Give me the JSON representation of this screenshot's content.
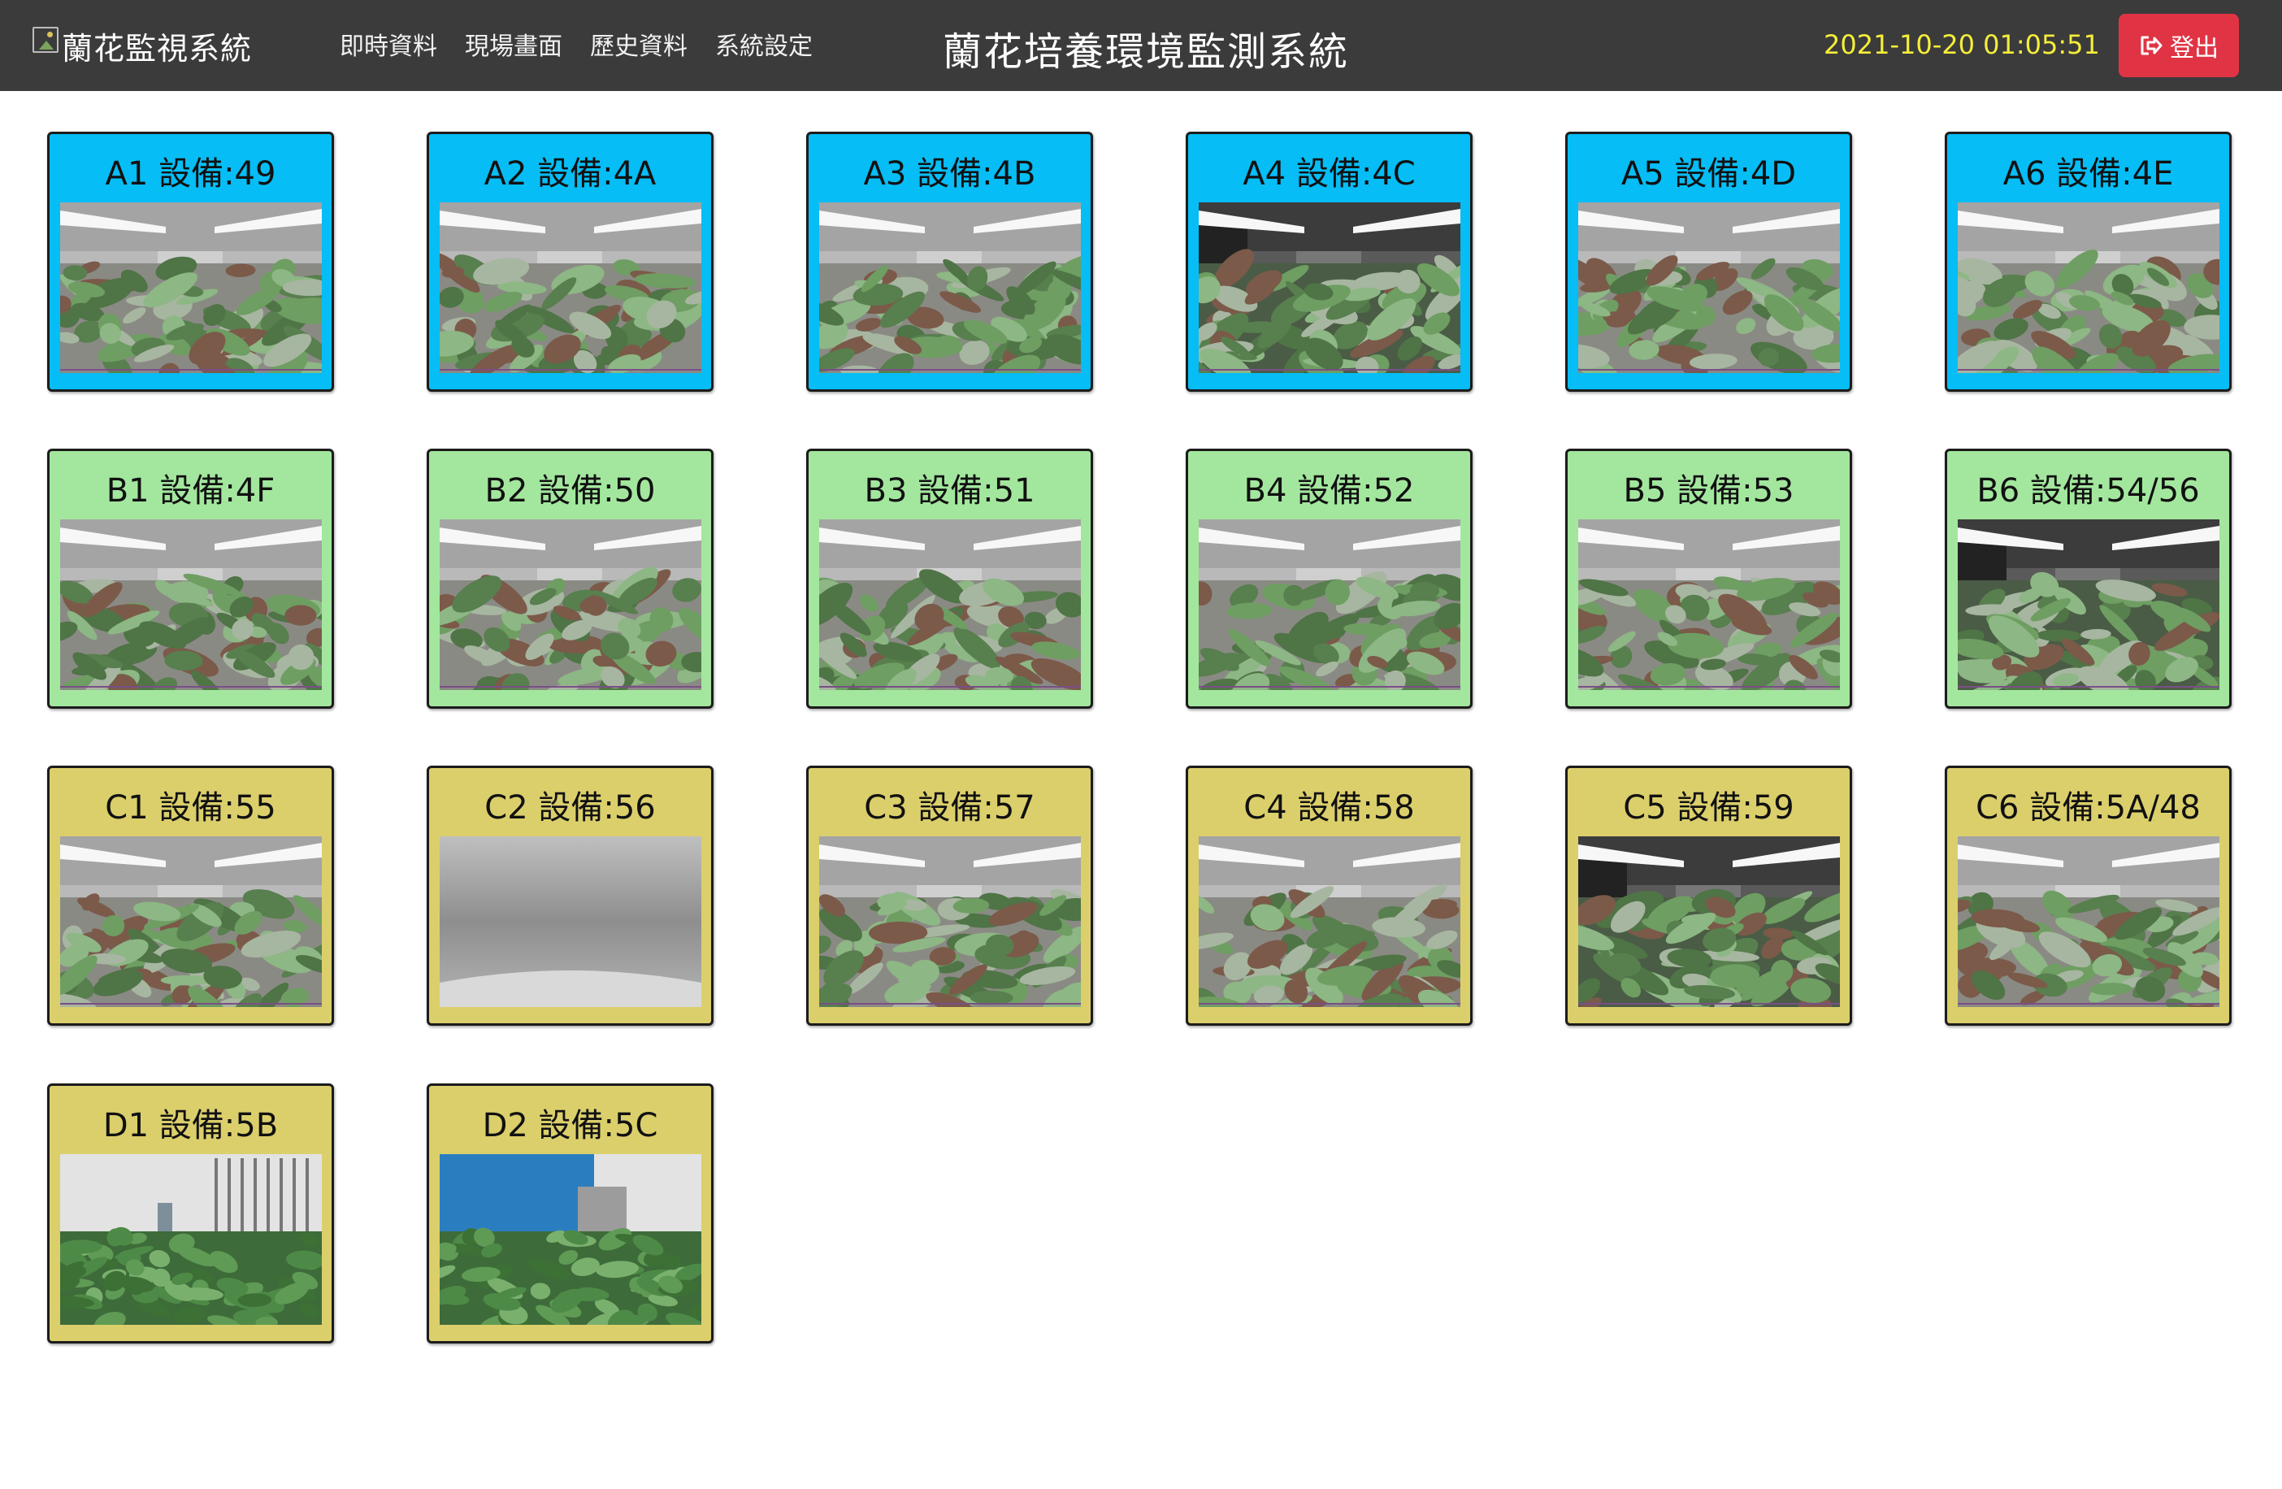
{
  "header": {
    "brand_text": "蘭花監視系統",
    "nav": [
      "即時資料",
      "現場畫面",
      "歷史資料",
      "系統設定"
    ],
    "title": "蘭花培養環境監測系統",
    "datetime": "2021-10-20 01:05:51",
    "logout_label": "登出",
    "logout_icon": "sign-out-icon"
  },
  "colors": {
    "navbar": "#3b3b3b",
    "datetime": "#f4ee3a",
    "logout": "#e03444",
    "group_a": "#06bdf5",
    "group_b": "#a3e79e",
    "group_c": "#dbcf6c",
    "group_d": "#dbcf6c"
  },
  "devices": [
    {
      "label": "A1 設備:49",
      "group": "A",
      "scene": "shelf"
    },
    {
      "label": "A2 設備:4A",
      "group": "A",
      "scene": "shelf"
    },
    {
      "label": "A3 設備:4B",
      "group": "A",
      "scene": "shelf"
    },
    {
      "label": "A4 設備:4C",
      "group": "A",
      "scene": "shelf-dark"
    },
    {
      "label": "A5 設備:4D",
      "group": "A",
      "scene": "shelf"
    },
    {
      "label": "A6 設備:4E",
      "group": "A",
      "scene": "shelf"
    },
    {
      "label": "B1 設備:4F",
      "group": "B",
      "scene": "shelf"
    },
    {
      "label": "B2 設備:50",
      "group": "B",
      "scene": "shelf"
    },
    {
      "label": "B3 設備:51",
      "group": "B",
      "scene": "shelf"
    },
    {
      "label": "B4 設備:52",
      "group": "B",
      "scene": "shelf"
    },
    {
      "label": "B5 設備:53",
      "group": "B",
      "scene": "shelf"
    },
    {
      "label": "B6 設備:54/56",
      "group": "B",
      "scene": "shelf-dark"
    },
    {
      "label": "C1 設備:55",
      "group": "C",
      "scene": "shelf"
    },
    {
      "label": "C2 設備:56",
      "group": "C",
      "scene": "blank"
    },
    {
      "label": "C3 設備:57",
      "group": "C",
      "scene": "shelf"
    },
    {
      "label": "C4 設備:58",
      "group": "C",
      "scene": "shelf"
    },
    {
      "label": "C5 設備:59",
      "group": "C",
      "scene": "shelf-dark"
    },
    {
      "label": "C6 設備:5A/48",
      "group": "C",
      "scene": "shelf"
    },
    {
      "label": "D1 設備:5B",
      "group": "D",
      "scene": "greenhouse"
    },
    {
      "label": "D2 設備:5C",
      "group": "D",
      "scene": "greenhouse-blue"
    }
  ]
}
